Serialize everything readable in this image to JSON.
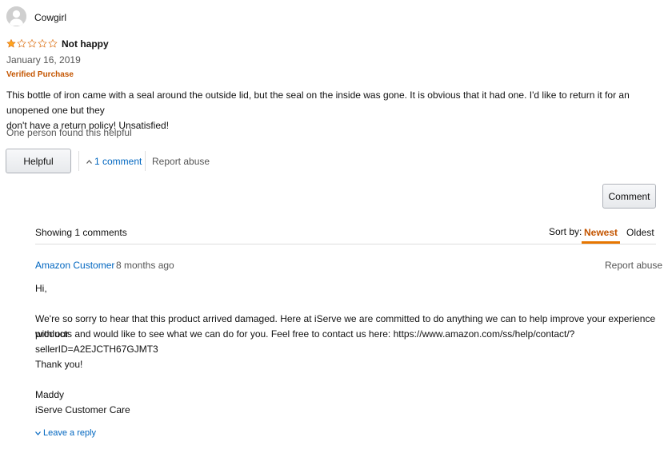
{
  "review": {
    "reviewer_name": "Cowgirl",
    "rating": 1,
    "max_rating": 5,
    "title": "Not happy",
    "date": "January 16, 2019",
    "verified_label": "Verified Purchase",
    "body_line1": "This bottle of iron came with a seal around the outside lid, but the seal on the inside was gone. It is obvious that it had one. I'd like to return it for an unopened one but they",
    "body_line2": "don't have a return policy! Unsatisfied!",
    "helpful_count_text": "One person found this helpful",
    "helpful_button": "Helpful",
    "comments_link": "1 comment",
    "report_abuse": "Report abuse"
  },
  "comment_button": "Comment",
  "comments": {
    "showing_text": "Showing 1 comments",
    "sort_label": "Sort by:",
    "sort_newest": "Newest",
    "sort_oldest": "Oldest",
    "item": {
      "author": "Amazon Customer",
      "time": "8 months ago",
      "report_abuse": "Report abuse",
      "line1": "Hi,",
      "line2": "We're so sorry to hear that this product arrived damaged. Here at iServe we are committed to do anything we can to help improve your experience with our",
      "line3": "products and would like to see what we can do for you. Feel free to contact us here: https://www.amazon.com/ss/help/contact/?sellerID=A2EJCTH67GJMT3",
      "line4": "Thank you!",
      "line5": "Maddy",
      "line6": "iServe Customer Care"
    },
    "leave_reply": "Leave a reply"
  },
  "colors": {
    "star_fill": "#ffa41c",
    "star_outline": "#de7921",
    "link": "#0066c0",
    "accent_orange": "#c45500",
    "tab_underline": "#e77600"
  },
  "icons": {
    "avatar": "user-avatar-icon",
    "star": "star-icon",
    "chevron_up": "chevron-up-icon",
    "chevron_down": "chevron-down-icon"
  }
}
